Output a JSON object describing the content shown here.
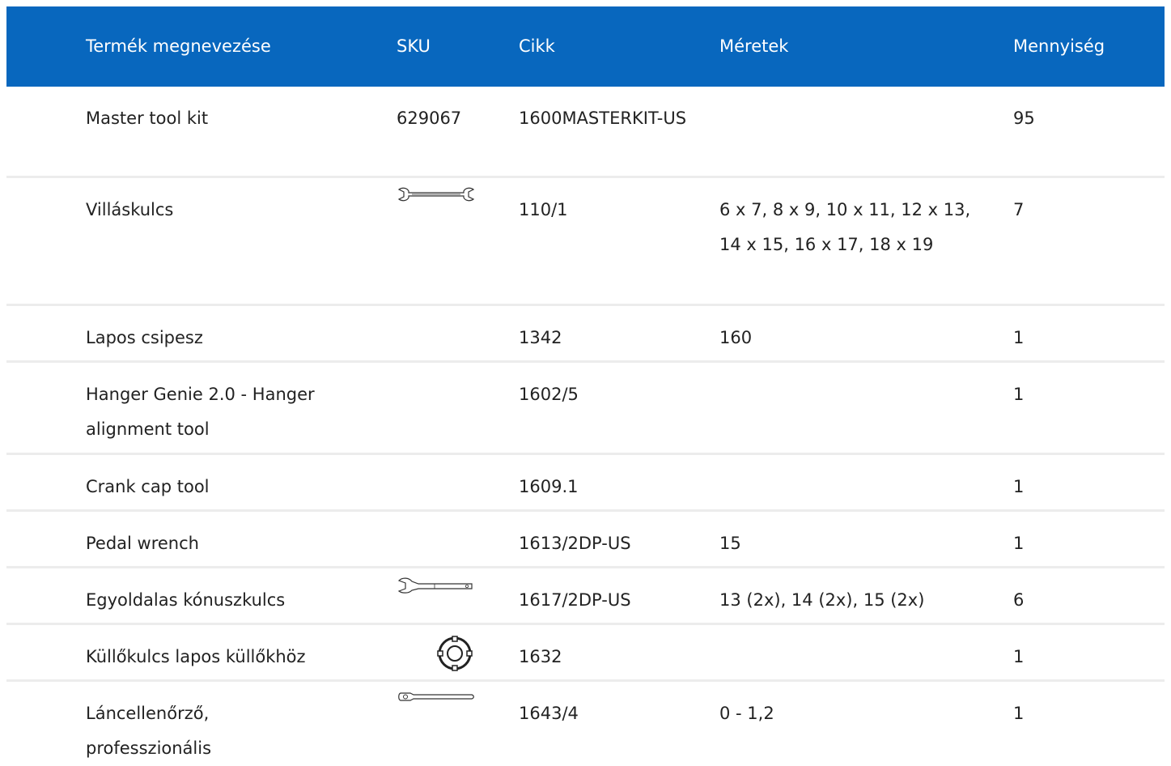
{
  "table": {
    "headers": [
      "Termék megnevezése",
      "SKU",
      "Cikk",
      "Méretek",
      "Mennyiség"
    ],
    "rows": [
      {
        "name": "Master tool kit",
        "sku": "629067",
        "article": "1600MASTERKIT-US",
        "dimensions": "",
        "qty": "95",
        "icon": ""
      },
      {
        "name": "Villáskulcs",
        "sku": "",
        "article": "110/1",
        "dimensions": "6 x 7, 8 x 9, 10 x 11, 12 x 13, 14 x 15, 16 x 17, 18 x 19",
        "qty": "7",
        "icon": "open-end-wrench-icon"
      },
      {
        "name": "Lapos csipesz",
        "sku": "",
        "article": "1342",
        "dimensions": "160",
        "qty": "1",
        "icon": ""
      },
      {
        "name": "Hanger Genie 2.0 - Hanger alignment tool",
        "sku": "",
        "article": "1602/5",
        "dimensions": "",
        "qty": "1",
        "icon": ""
      },
      {
        "name": "Crank cap tool",
        "sku": "",
        "article": "1609.1",
        "dimensions": "",
        "qty": "1",
        "icon": ""
      },
      {
        "name": "Pedal wrench",
        "sku": "",
        "article": "1613/2DP-US",
        "dimensions": "15",
        "qty": "1",
        "icon": ""
      },
      {
        "name": "Egyoldalas kónuszkulcs",
        "sku": "",
        "article": "1617/2DP-US",
        "dimensions": "13 (2x), 14 (2x), 15 (2x)",
        "qty": "6",
        "icon": "cone-wrench-icon"
      },
      {
        "name": "Küllőkulcs lapos küllőkhöz",
        "sku": "",
        "article": "1632",
        "dimensions": "",
        "qty": "1",
        "icon": "spoke-wrench-icon"
      },
      {
        "name": "Láncellenőrző, professzionális",
        "sku": "",
        "article": "1643/4",
        "dimensions": "0 - 1,2",
        "qty": "1",
        "icon": "chain-checker-icon"
      }
    ]
  },
  "colors": {
    "header_bg": "#0867be",
    "header_text": "#ffffff",
    "divider": "#ececec",
    "text": "#222222"
  }
}
